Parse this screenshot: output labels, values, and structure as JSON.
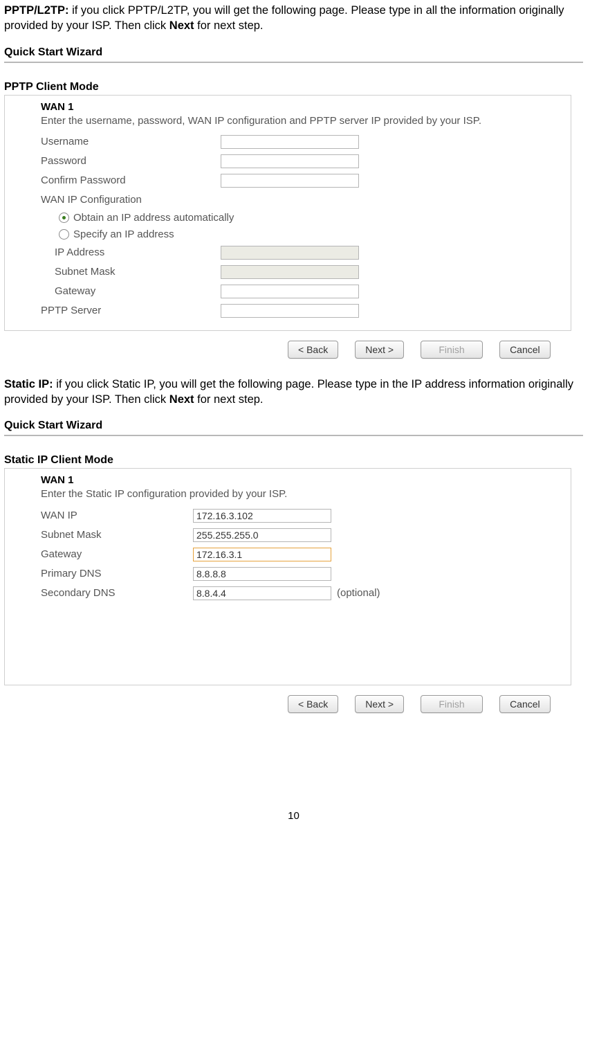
{
  "pptp_desc": {
    "strong": "PPTP/L2TP:",
    "text1": " if you click PPTP/L2TP, you will get the following page. Please type in all the information originally provided by your ISP. Then click ",
    "next": "Next",
    "text2": " for next step."
  },
  "pptp": {
    "wizard_title": "Quick Start Wizard",
    "mode_title": "PPTP Client Mode",
    "wan_h": "WAN 1",
    "intro": "Enter the username, password, WAN IP configuration and PPTP server IP provided by your ISP.",
    "labels": {
      "username": "Username",
      "password": "Password",
      "confirm": "Confirm Password",
      "wanipcfg": "WAN IP Configuration",
      "obtain": "Obtain an IP address automatically",
      "specify": "Specify an IP address",
      "ip": "IP Address",
      "subnet": "Subnet Mask",
      "gateway": "Gateway",
      "server": "PPTP Server"
    },
    "values": {
      "username": "",
      "password": "",
      "confirm": "",
      "ip": "",
      "subnet": "",
      "gateway": "",
      "server": ""
    }
  },
  "static_desc": {
    "strong": "Static IP:",
    "text1": " if you click Static IP, you will get the following page. Please type in the IP address information originally provided by your ISP. Then click ",
    "next": "Next",
    "text2": " for next step."
  },
  "static": {
    "wizard_title": "Quick Start Wizard",
    "mode_title": "Static IP Client Mode",
    "wan_h": "WAN 1",
    "intro": "Enter the Static IP configuration provided by your ISP.",
    "labels": {
      "wanip": "WAN IP",
      "subnet": "Subnet Mask",
      "gateway": "Gateway",
      "pdns": "Primary DNS",
      "sdns": "Secondary DNS",
      "optional": "(optional)"
    },
    "values": {
      "wanip": "172.16.3.102",
      "subnet": "255.255.255.0",
      "gateway": "172.16.3.1",
      "pdns": "8.8.8.8",
      "sdns": "8.8.4.4"
    }
  },
  "buttons": {
    "back": "< Back",
    "next": "Next >",
    "finish": "Finish",
    "cancel": "Cancel"
  },
  "page_number": "10"
}
